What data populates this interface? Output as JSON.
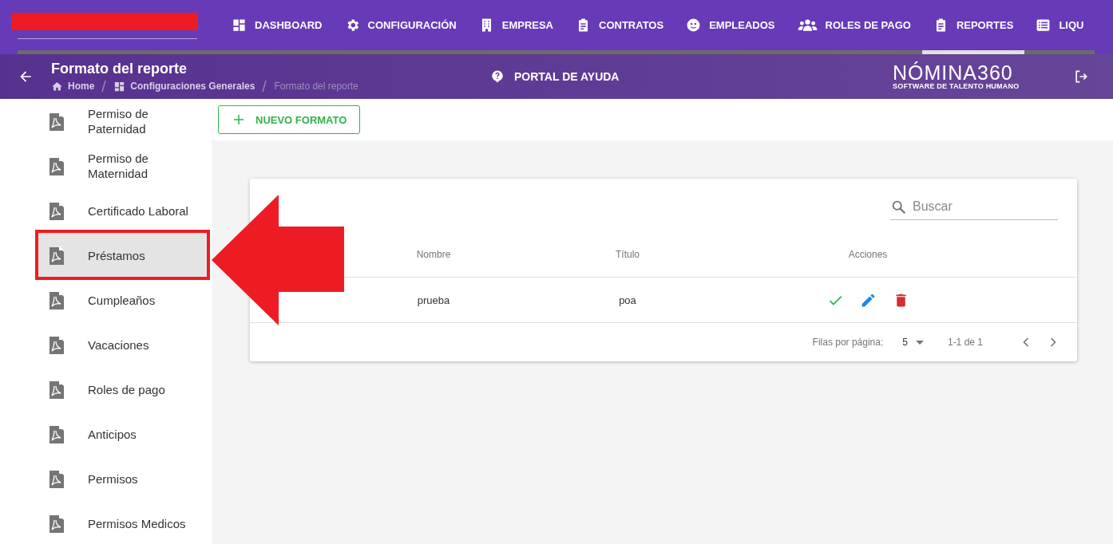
{
  "nav": {
    "items": [
      {
        "label": "DASHBOARD",
        "kind": "dashboard",
        "selected": false
      },
      {
        "label": "CONFIGURACIÓN",
        "kind": "gear",
        "selected": false
      },
      {
        "label": "EMPRESA",
        "kind": "building",
        "selected": false
      },
      {
        "label": "CONTRATOS",
        "kind": "clipboard",
        "selected": false
      },
      {
        "label": "EMPLEADOS",
        "kind": "face",
        "selected": false
      },
      {
        "label": "ROLES DE PAGO",
        "kind": "group",
        "selected": false
      },
      {
        "label": "REPORTES",
        "kind": "clipboard",
        "selected": true
      },
      {
        "label": "LIQU",
        "kind": "list",
        "selected": false
      }
    ]
  },
  "header": {
    "title": "Formato del reporte",
    "breadcrumbs": [
      {
        "label": "Home",
        "kind": "home"
      },
      {
        "label": "Configuraciones Generales",
        "kind": "dashboard"
      },
      {
        "label": "Formato del reporte",
        "kind": "plain"
      }
    ],
    "help": "PORTAL DE AYUDA",
    "brand": "NÓMINA360",
    "brand_tagline": "SOFTWARE DE TALENTO HUMANO"
  },
  "sidebar": {
    "items": [
      {
        "label": "Permiso de Paternidad",
        "selected": false,
        "highlighted": false
      },
      {
        "label": "Permiso de Maternidad",
        "selected": false,
        "highlighted": false
      },
      {
        "label": "Certificado Laboral",
        "selected": false,
        "highlighted": false
      },
      {
        "label": "Préstamos",
        "selected": true,
        "highlighted": true
      },
      {
        "label": "Cumpleaños",
        "selected": false,
        "highlighted": false
      },
      {
        "label": "Vacaciones",
        "selected": false,
        "highlighted": false
      },
      {
        "label": "Roles de pago",
        "selected": false,
        "highlighted": false
      },
      {
        "label": "Anticipos",
        "selected": false,
        "highlighted": false
      },
      {
        "label": "Permisos",
        "selected": false,
        "highlighted": false
      },
      {
        "label": "Permisos Medicos",
        "selected": false,
        "highlighted": false
      }
    ]
  },
  "new_button": "NUEVO FORMATO",
  "search": {
    "placeholder": "Buscar"
  },
  "table": {
    "columns": [
      "Nombre",
      "Título",
      "Acciones"
    ],
    "rows": [
      {
        "cells": [
          "prueba",
          "poa"
        ]
      }
    ]
  },
  "pagination": {
    "rows_per_page_label": "Filas por página:",
    "rows_per_page": "5",
    "range": "1-1 de 1"
  }
}
